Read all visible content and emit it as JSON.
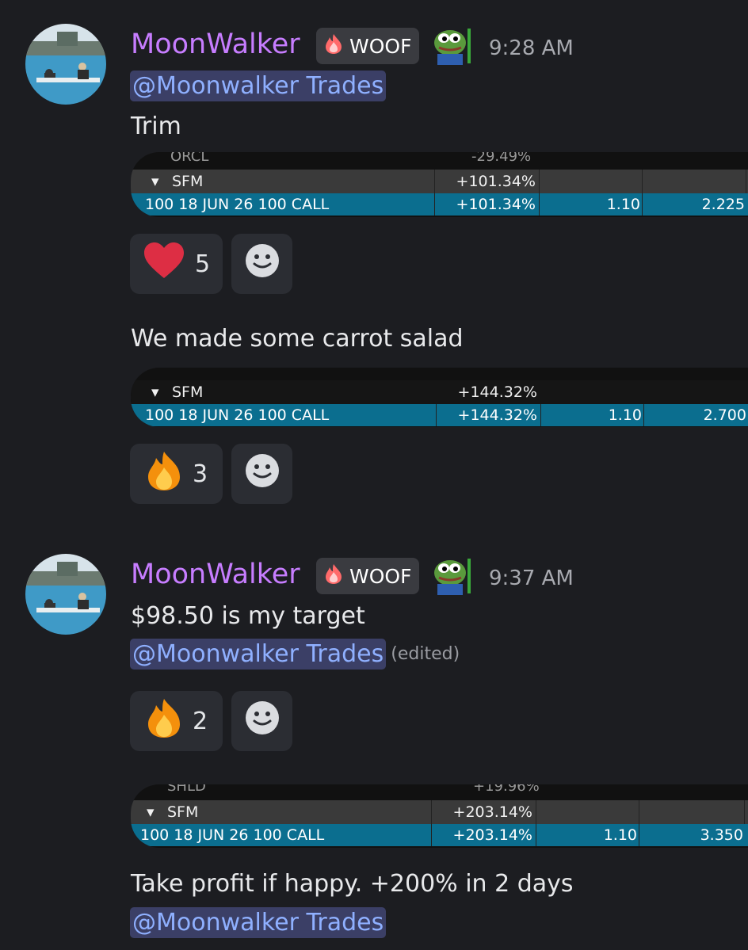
{
  "messages": [
    {
      "username": "MoonWalker",
      "badge": "WOOF",
      "time": "9:28 AM",
      "mention": "@Moonwalker Trades",
      "text": "Trim",
      "table": {
        "partial_symbol": "ORCL",
        "partial_pct": "-29.49%",
        "symbol": "SFM",
        "symbol_pct": "+101.34%",
        "option": "100 18 JUN 26 100 CALL",
        "option_pct": "+101.34%",
        "cost": "1.10",
        "price": "2.225"
      },
      "reactions": [
        {
          "emoji": "heart",
          "count": "5"
        }
      ]
    },
    {
      "text": "We made some carrot salad",
      "table": {
        "symbol": "SFM",
        "symbol_pct": "+144.32%",
        "option": "100 18 JUN 26 100 CALL",
        "option_pct": "+144.32%",
        "cost": "1.10",
        "price": "2.700"
      },
      "reactions": [
        {
          "emoji": "fire",
          "count": "3"
        }
      ]
    },
    {
      "username": "MoonWalker",
      "badge": "WOOF",
      "time": "9:37 AM",
      "text": "$98.50 is my target",
      "mention": "@Moonwalker Trades",
      "edited": "(edited)",
      "reactions": [
        {
          "emoji": "fire",
          "count": "2"
        }
      ]
    },
    {
      "table": {
        "partial_symbol": "SHLD",
        "partial_pct": "+19.96%",
        "symbol": "SFM",
        "symbol_pct": "+203.14%",
        "option": "100 18 JUN 26 100 CALL",
        "option_pct": "+203.14%",
        "cost": "1.10",
        "price": "3.350"
      },
      "text": "Take profit if happy. +200% in 2 days",
      "mention": "@Moonwalker Trades"
    }
  ],
  "colors": {
    "background": "#1c1d21",
    "username": "#c77dff",
    "mention_bg": "#3b3f66",
    "mention_text": "#8fb0ff",
    "option_row": "#0b6e8f"
  }
}
